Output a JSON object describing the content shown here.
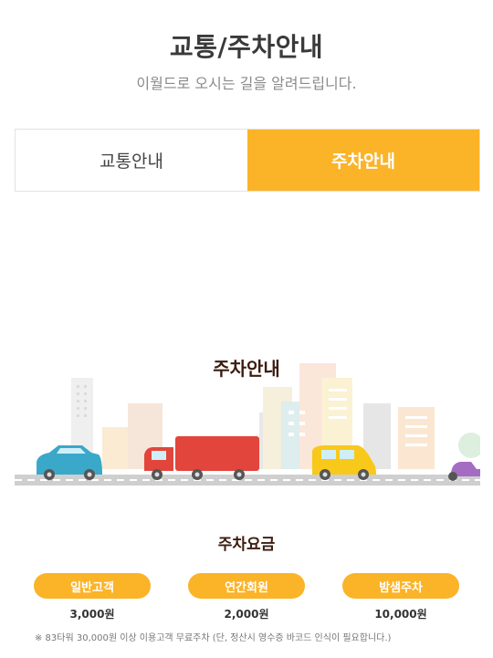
{
  "header": {
    "title": "교통/주차안내",
    "subtitle": "이월드로 오시는 길을 알려드립니다."
  },
  "tabs": [
    {
      "label": "교통안내",
      "active": false
    },
    {
      "label": "주차안내",
      "active": true
    }
  ],
  "parking": {
    "heading": "주차안내",
    "fee_heading": "주차요금",
    "fees": [
      {
        "label": "일반고객",
        "price": "3,000원"
      },
      {
        "label": "연간회원",
        "price": "2,000원"
      },
      {
        "label": "밤샘주차",
        "price": "10,000원"
      }
    ],
    "note": "※ 83타워 30,000원 이상 이용고객 무료주차 (단, 정산시 영수증 바코드 인식이 필요합니다.)"
  },
  "colors": {
    "accent": "#fbb328",
    "heading_dark": "#3b1d0f"
  }
}
